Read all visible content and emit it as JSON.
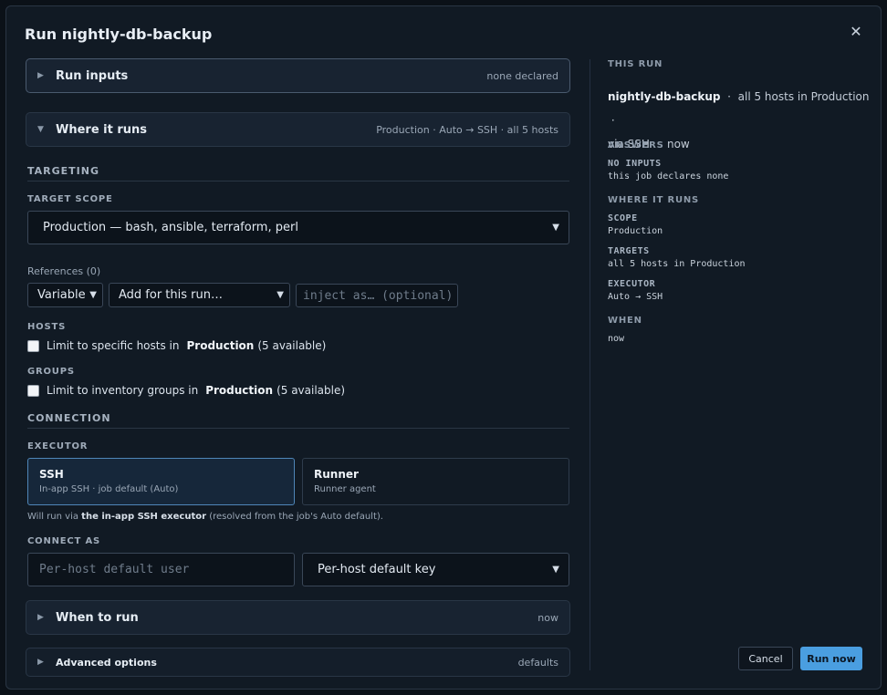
{
  "modal": {
    "title": "Run nightly-db-backup",
    "close_glyph": "✕"
  },
  "sections": {
    "run_inputs": {
      "caret": "▶",
      "label": "Run inputs",
      "summary": "none declared"
    },
    "where_it_runs": {
      "caret": "▼",
      "label": "Where it runs",
      "summary": "Production · Auto → SSH · all 5 hosts"
    },
    "when_to_run": {
      "caret": "▶",
      "label": "When to run",
      "summary": "now"
    },
    "advanced": {
      "caret": "▶",
      "label": "Advanced options",
      "summary": "defaults"
    }
  },
  "targeting": {
    "heading": "TARGETING",
    "scope_label": "TARGET SCOPE",
    "scope_value": "Production — bash, ansible, terraform, perl",
    "references_label": "References (0)",
    "ref_type_value": "Variable",
    "ref_add_value": "Add for this run…",
    "inject_placeholder": "inject as… (optional)",
    "hosts_label": "HOSTS",
    "hosts_check_text": "Limit to specific hosts in",
    "hosts_scope": "Production",
    "hosts_available": "(5 available)",
    "groups_label": "GROUPS",
    "groups_check_text": "Limit to inventory groups in",
    "groups_scope": "Production",
    "groups_available": "(5 available)"
  },
  "connection": {
    "heading": "CONNECTION",
    "executor_label": "EXECUTOR",
    "executors": [
      {
        "name": "SSH",
        "desc": "In-app SSH · job default (Auto)",
        "selected": true
      },
      {
        "name": "Runner",
        "desc": "Runner agent",
        "selected": false
      }
    ],
    "note_prefix": "Will run via",
    "note_bold": "the in-app SSH executor",
    "note_suffix": "(resolved from the job's Auto default).",
    "connect_as_label": "CONNECT AS",
    "user_placeholder": "Per-host default user",
    "key_value": "Per-host default key"
  },
  "summary_panel": {
    "this_run_heading": "THIS RUN",
    "job_name": "nightly-db-backup",
    "sep": "·",
    "hosts_text": "all 5 hosts in Production",
    "via_text": "via SSH",
    "when_text": "now",
    "answers_heading": "ANSWERS",
    "no_inputs_key": "NO INPUTS",
    "no_inputs_val": "this job declares none",
    "where_heading": "WHERE IT RUNS",
    "scope_key": "SCOPE",
    "scope_val": "Production",
    "targets_key": "TARGETS",
    "targets_val": "all 5 hosts in Production",
    "executor_key": "EXECUTOR",
    "executor_val": "Auto → SSH",
    "when_key": "WHEN",
    "when_val": "now"
  },
  "actions": {
    "cancel": "Cancel",
    "run_now": "Run now"
  }
}
